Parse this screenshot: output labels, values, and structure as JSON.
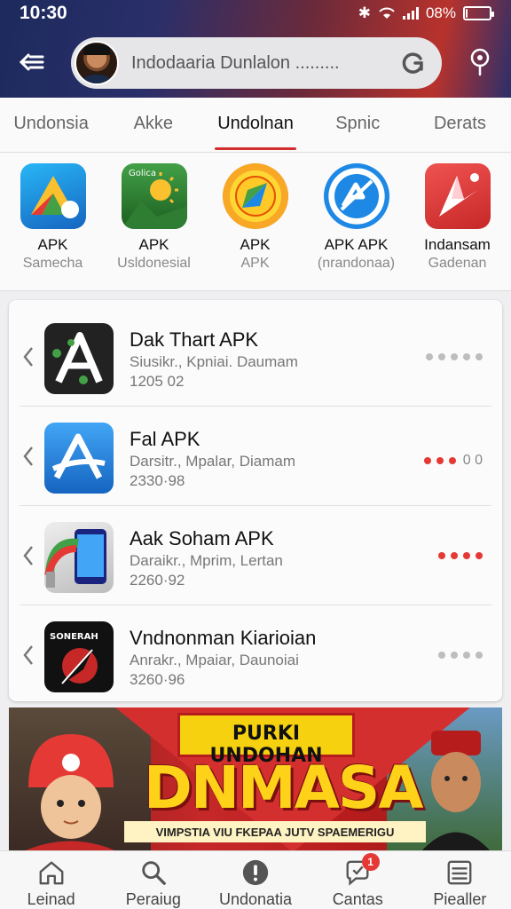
{
  "status": {
    "time": "10:30",
    "battery": "08%",
    "battery_level": 0.08
  },
  "search": {
    "placeholder": "Indodaaria Dunlalon ........."
  },
  "tabs": [
    {
      "label": "Undonsia",
      "active": false
    },
    {
      "label": "Akke",
      "active": false
    },
    {
      "label": "Undolnan",
      "active": true
    },
    {
      "label": "Spnic",
      "active": false
    },
    {
      "label": "Derats",
      "active": false
    }
  ],
  "featured": [
    {
      "title": "APK",
      "subtitle": "Samecha",
      "icon": "triangle-drive-icon",
      "icon_text": ""
    },
    {
      "title": "APK",
      "subtitle": "Usldonesial",
      "icon": "sun-landscape-icon",
      "icon_text": "Golica"
    },
    {
      "title": "APK",
      "subtitle": "APK",
      "icon": "compass-badge-icon",
      "icon_text": ""
    },
    {
      "title": "APK APK",
      "subtitle": "(nrandonaa)",
      "icon": "app-store-circle-icon",
      "icon_text": ""
    },
    {
      "title": "Indansam",
      "subtitle": "Gadenan",
      "icon": "red-arrow-icon",
      "icon_text": ""
    }
  ],
  "apps": [
    {
      "title": "Dak Thart APK",
      "subtitle": "Siusikr., Kpniai. Daumam",
      "number": "1205 02",
      "icon": "letter-a-dark-icon",
      "rating_colors": [
        "#bdbdbd",
        "#bdbdbd",
        "#bdbdbd",
        "#bdbdbd",
        "#bdbdbd"
      ],
      "rating_suffix": ""
    },
    {
      "title": "Fal APK",
      "subtitle": "Darsitr., Mpalar, Diamam",
      "number": "2330·98",
      "icon": "letter-a-blue-icon",
      "rating_colors": [
        "#e53935",
        "#e53935",
        "#e53935"
      ],
      "rating_suffix": "0 0"
    },
    {
      "title": "Aak Soham APK",
      "subtitle": "Daraikr., Mprim, Lertan",
      "number": "2260·92",
      "icon": "phone-plug-icon",
      "rating_colors": [
        "#e53935",
        "#e53935",
        "#e53935",
        "#e53935"
      ],
      "rating_suffix": ""
    },
    {
      "title": "Vndnonman Kiarioian",
      "subtitle": "Anrakr., Mpaiar, Daunoiai",
      "number": "3260·96",
      "icon": "sonerah-icon",
      "rating_colors": [
        "#bdbdbd",
        "#bdbdbd",
        "#bdbdbd",
        "#bdbdbd"
      ],
      "rating_suffix": "",
      "icon_text": "SONERAH"
    }
  ],
  "banner": {
    "top_text": "PURKI UNDOHAN",
    "big_text": "DNMASA",
    "strip_text": "VIMPSTIA VIU FKEPAA JUTV SPAEMERIGU"
  },
  "bottom_nav": [
    {
      "label": "Leinad",
      "icon": "home-icon"
    },
    {
      "label": "Peraiug",
      "icon": "search-icon"
    },
    {
      "label": "Undonatia",
      "icon": "info-icon"
    },
    {
      "label": "Cantas",
      "icon": "chat-icon",
      "badge": "1"
    },
    {
      "label": "Piealler",
      "icon": "list-icon"
    }
  ],
  "colors": {
    "accent": "#d32f2f",
    "header_dark": "#1d2a5c"
  }
}
